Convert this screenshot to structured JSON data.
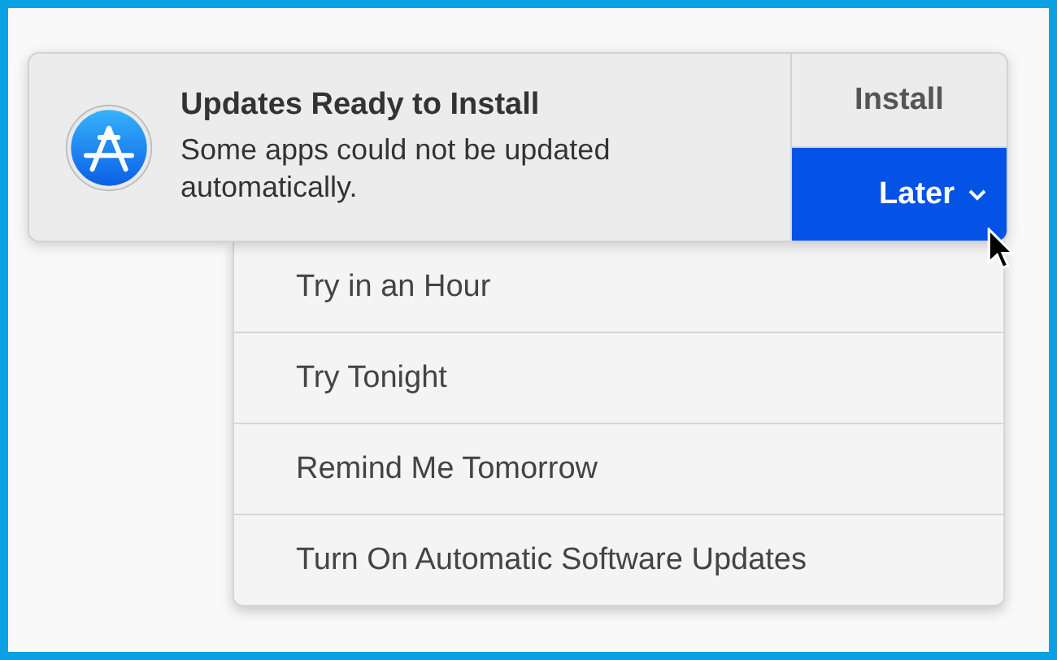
{
  "notification": {
    "title": "Updates Ready to Install",
    "message": "Some apps could not be updated automatically.",
    "buttons": [
      {
        "label": "Install",
        "selected": false,
        "dropdown": false
      },
      {
        "label": "Later",
        "selected": true,
        "dropdown": true
      }
    ]
  },
  "menu": {
    "items": [
      {
        "label": "Try in an Hour"
      },
      {
        "label": "Try Tonight"
      },
      {
        "label": "Remind Me Tomorrow"
      },
      {
        "label": "Turn On Automatic Software Updates"
      }
    ]
  }
}
